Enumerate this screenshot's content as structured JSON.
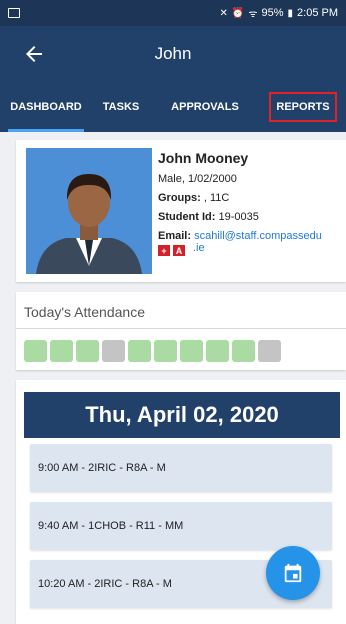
{
  "status_bar": {
    "battery": "95%",
    "time": "2:05 PM"
  },
  "app_bar": {
    "title": "John",
    "back_icon": "arrow-left-icon"
  },
  "tabs": [
    {
      "label": "DASHBOARD",
      "active": true
    },
    {
      "label": "TASKS",
      "active": false
    },
    {
      "label": "APPROVALS",
      "active": false
    },
    {
      "label": "REPORTS",
      "active": false,
      "highlight_color": "#e0232a"
    }
  ],
  "profile": {
    "name": "John Mooney",
    "gender_dob": "Male, 1/02/2000",
    "groups_label": "Groups:",
    "groups_value": " , 11C",
    "student_id_label": "Student Id:",
    "student_id_value": " 19-0035",
    "email_label": "Email:",
    "email_value_line1": "scahill@staff.compassedu",
    "email_value_line2": ".ie",
    "flags": [
      "+",
      "A"
    ]
  },
  "attendance": {
    "title": "Today's Attendance",
    "slots": [
      "present",
      "present",
      "present",
      "none",
      "present",
      "present",
      "present",
      "present",
      "present",
      "none"
    ],
    "colors": {
      "present": "#a9dba3",
      "none": "#c4c4c4"
    }
  },
  "schedule": {
    "date": "Thu, April 02, 2020",
    "slots": [
      "9:00 AM - 2IRIC - R8A - M",
      "9:40 AM - 1CHOB - R11 - MM",
      "10:20 AM - 2IRIC - R8A - M"
    ]
  },
  "fab": {
    "icon": "calendar-icon"
  },
  "colors": {
    "primary": "#22416a",
    "accent": "#2493e8",
    "tab_indicator": "#4aa3f0"
  }
}
